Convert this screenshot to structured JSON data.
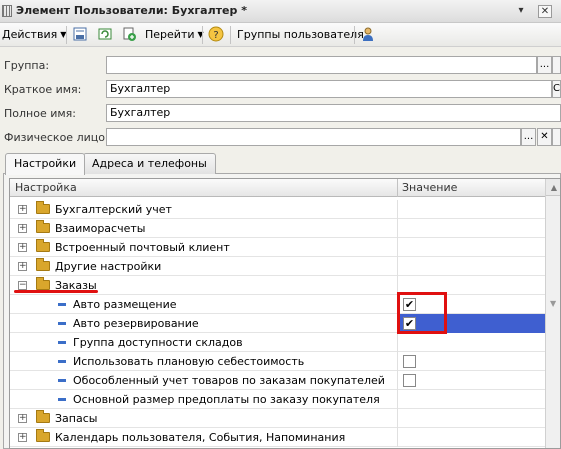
{
  "window": {
    "title": "Элемент Пользователи: Бухгалтер *",
    "menu_glyph": "▾",
    "close_glyph": "✕"
  },
  "toolbar": {
    "actions_label": "Действия",
    "goto_label": "Перейти",
    "help_glyph": "?",
    "user_groups_label": "Группы пользователя"
  },
  "form": {
    "group_label": "Группа:",
    "group_value": "",
    "short_name_label": "Краткое имя:",
    "short_name_value": "Бухгалтер",
    "full_name_label": "Полное имя:",
    "full_name_value": "Бухгалтер",
    "person_label": "Физическое лицо:",
    "person_value": "",
    "select_glyph": "...",
    "clear_glyph": "✕",
    "cut_glyph": "С"
  },
  "tabs": [
    {
      "label": "Настройки"
    },
    {
      "label": "Адреса и телефоны"
    }
  ],
  "grid": {
    "col_setting": "Настройка",
    "col_value": "Значение",
    "rows": [
      {
        "label": "Бухгалтерский учет"
      },
      {
        "label": "Взаиморасчеты"
      },
      {
        "label": "Встроенный почтовый клиент"
      },
      {
        "label": "Другие настройки"
      },
      {
        "label": "Заказы"
      },
      {
        "label": "Авто размещение",
        "checked": "✔"
      },
      {
        "label": "Авто резервирование",
        "checked": "✔"
      },
      {
        "label": "Группа доступности складов"
      },
      {
        "label": "Использовать плановую себестоимость",
        "checked": ""
      },
      {
        "label": "Обособленный учет товаров по заказам покупателей",
        "checked": ""
      },
      {
        "label": "Основной размер предоплаты по заказу покупателя"
      },
      {
        "label": "Запасы"
      },
      {
        "label": "Календарь пользователя, События, Напоминания"
      }
    ],
    "expand_glyph": "+",
    "collapse_glyph": "−"
  },
  "colors": {
    "highlight": "#e01010",
    "selection": "#3f5fd0",
    "folder": "#d9a62c"
  }
}
